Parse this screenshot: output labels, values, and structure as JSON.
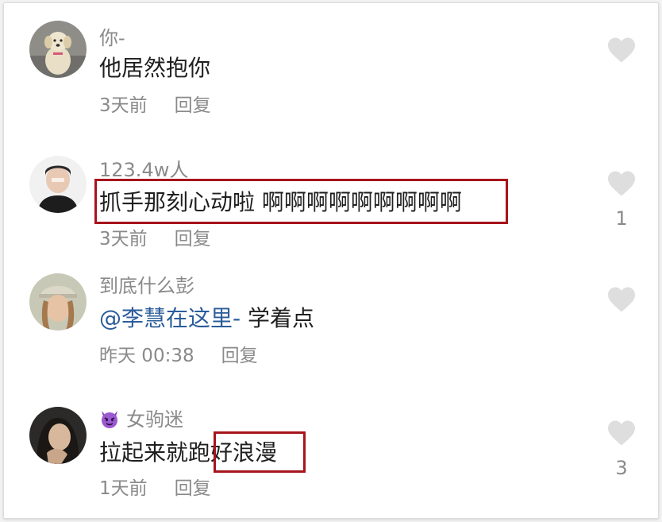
{
  "colors": {
    "highlight": "#a6141c",
    "mention": "#2b5c9a",
    "meta": "#8a8a8a",
    "heart": "#dedede"
  },
  "comments": [
    {
      "avatar": "dog-avatar",
      "username": "你-",
      "text": "他居然抱你",
      "time": "3天前",
      "reply": "回复",
      "likes": ""
    },
    {
      "avatar": "person-avatar",
      "username": "123.4w人",
      "text": "抓手那刻心动啦 啊啊啊啊啊啊啊啊啊",
      "time": "3天前",
      "reply": "回复",
      "likes": "1"
    },
    {
      "avatar": "woman-cap-avatar",
      "username": "到底什么彭",
      "mention": "@李慧在这里-",
      "text": " 学着点",
      "time": "昨天 00:38",
      "reply": "回复",
      "likes": ""
    },
    {
      "avatar": "woman-avatar",
      "username_icon": "devil-emoji-icon",
      "username": "女驹迷",
      "text_a": "拉起来就跑",
      "text_b": "好浪漫",
      "time": "1天前",
      "reply": "回复",
      "likes": "3"
    }
  ]
}
